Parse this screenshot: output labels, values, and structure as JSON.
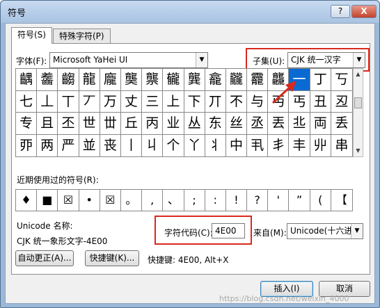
{
  "window": {
    "title": "符号",
    "help_label": "?",
    "close_label": "X"
  },
  "tabs": [
    {
      "label": "符号(S)"
    },
    {
      "label": "特殊字符(P)"
    }
  ],
  "font": {
    "label": "字体(F):",
    "value": "Microsoft YaHei UI"
  },
  "subset": {
    "label": "子集(U):",
    "value": "CJK 统一汉字"
  },
  "grid": {
    "selected_index": 13,
    "rows": [
      [
        "齵",
        "齹",
        "齺",
        "龍",
        "龐",
        "龑",
        "龒",
        "龓",
        "龔",
        "龕",
        "龖",
        "龗",
        "龘",
        "一",
        "丁",
        "丂"
      ],
      [
        "七",
        "丄",
        "丅",
        "丆",
        "万",
        "丈",
        "三",
        "上",
        "下",
        "丌",
        "不",
        "与",
        "丏",
        "丐",
        "丑",
        "丒"
      ],
      [
        "专",
        "且",
        "丕",
        "世",
        "丗",
        "丘",
        "丙",
        "业",
        "丛",
        "东",
        "丝",
        "丞",
        "丟",
        "丠",
        "両",
        "丢"
      ],
      [
        "丣",
        "两",
        "严",
        "並",
        "丧",
        "丨",
        "丩",
        "个",
        "丫",
        "丬",
        "中",
        "丮",
        "丯",
        "丰",
        "丱",
        "串"
      ]
    ]
  },
  "recent": {
    "label": "近期使用过的符号(R):",
    "symbols": [
      "♦",
      "■",
      "☒",
      "•",
      "☒",
      "。",
      ",",
      "、",
      ";",
      ":",
      "!",
      "?",
      "'",
      "”",
      "(",
      "【"
    ]
  },
  "unicode_name": {
    "label": "Unicode 名称:",
    "value": "CJK 统一象形文字-4E00"
  },
  "char_code": {
    "label": "字符代码(C):",
    "value": "4E00"
  },
  "from": {
    "label": "来自(M):",
    "value": "Unicode(十六进"
  },
  "buttons": {
    "autocorrect": "自动更正(A)...",
    "shortcut": "快捷键(K)...",
    "shortcut_text": "快捷键: 4E00, Alt+X",
    "insert": "插入(I)",
    "cancel": "取消"
  },
  "watermark": "https://blog.csdn.net/weixin_4000",
  "colors": {
    "highlight": "#d9291c",
    "selection": "#0a6ad3"
  }
}
